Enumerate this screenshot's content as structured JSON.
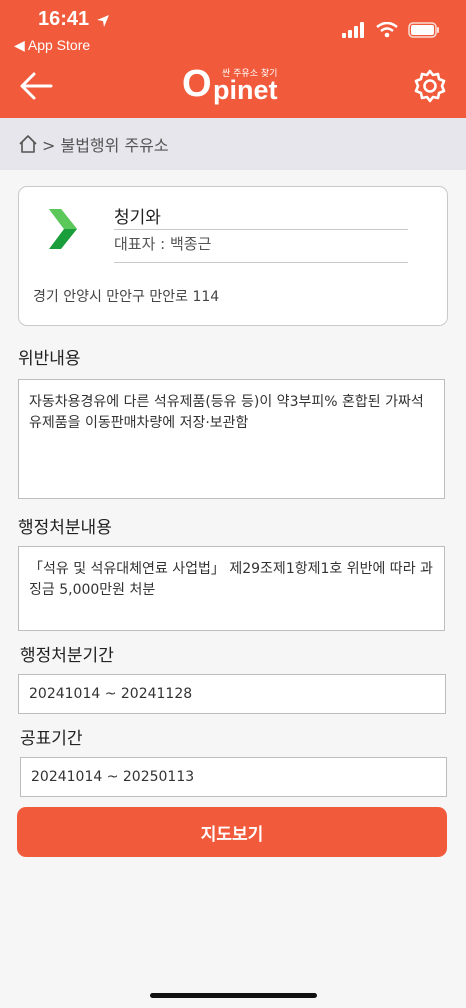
{
  "status_bar": {
    "time": "16:41",
    "back_app_label": "◀ App Store"
  },
  "header": {
    "logo_letter": "O",
    "logo_text": "pinet",
    "logo_subtitle": "싼 주유소 찾기",
    "accent_color": "#f15a3b"
  },
  "breadcrumb": {
    "text": "> 불법행위 주유소"
  },
  "station": {
    "name": "청기와",
    "representative": "대표자 : 백종근",
    "address": "경기 안양시 만안구 만안로 114"
  },
  "violation": {
    "label": "위반내용",
    "content": "자동차용경유에 다른 석유제품(등유 등)이 약3부피% 혼합된 가짜석유제품을 이동판매차량에 저장·보관함"
  },
  "disposition": {
    "label": "행정처분내용",
    "content": "「석유 및 석유대체연료 사업법」 제29조제1항제1호 위반에 따라 과징금 5,000만원 처분"
  },
  "disposition_period": {
    "label": "행정처분기간",
    "value": "20241014 ~ 20241128"
  },
  "announce_period": {
    "label": "공표기간",
    "value": "20241014 ~ 20250113"
  },
  "actions": {
    "map_button": "지도보기"
  }
}
